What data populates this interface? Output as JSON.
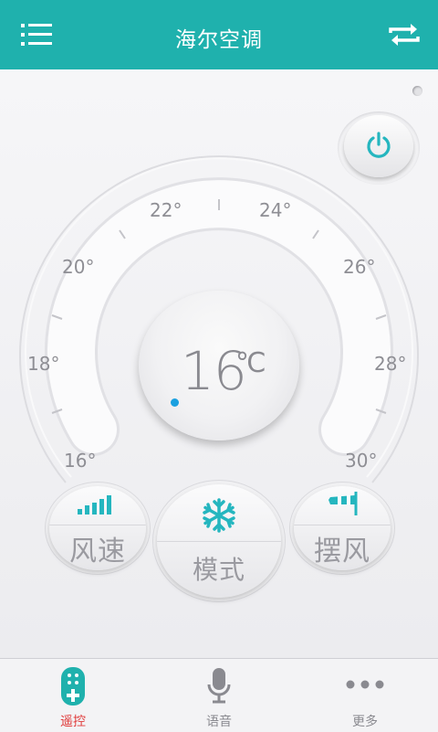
{
  "header": {
    "title": "海尔空调"
  },
  "dial": {
    "ticks": [
      "22°",
      "24°",
      "20°",
      "26°",
      "18°",
      "28°",
      "16°",
      "30°"
    ],
    "temperature": "16",
    "unit": "℃"
  },
  "controls": {
    "fan_speed": "风速",
    "mode": "模式",
    "swing": "摆风"
  },
  "tabs": [
    {
      "label": "遥控",
      "active": true,
      "color": "#e03c3c"
    },
    {
      "label": "语音",
      "active": false,
      "color": "#8a8a90"
    },
    {
      "label": "更多",
      "active": false,
      "color": "#8a8a90"
    }
  ],
  "colors": {
    "accent": "#1fb1ad",
    "icon_teal": "#25b6bf",
    "active_tab": "#e03c3c"
  }
}
